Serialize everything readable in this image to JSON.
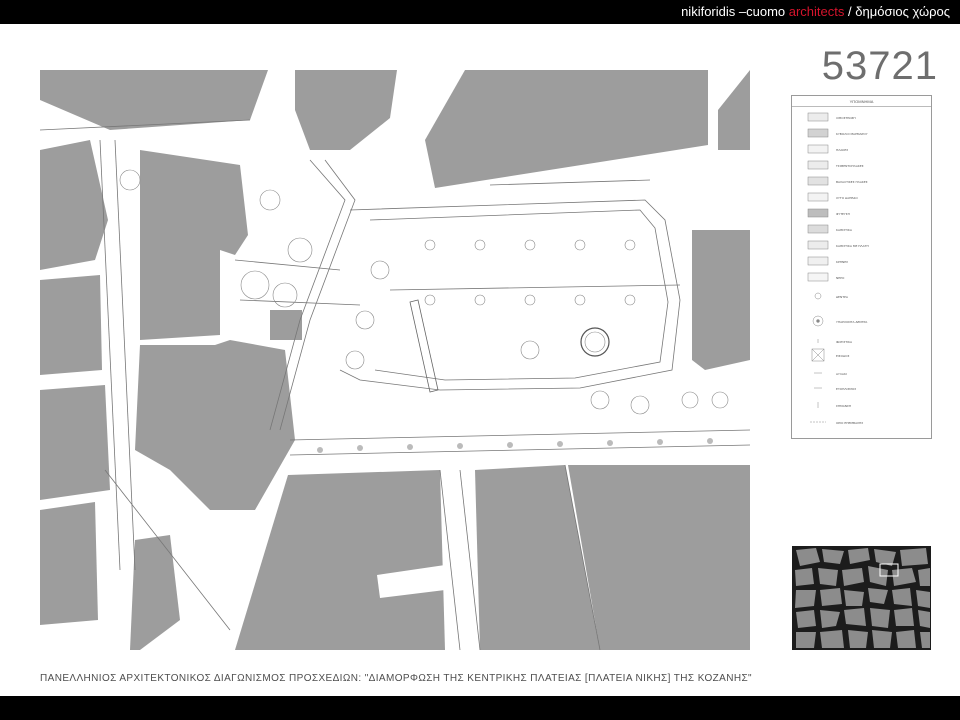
{
  "header": {
    "office": "nikiforidis –cuomo",
    "office_accent": "architects",
    "separator": "/",
    "section": "δημόσιος χώρος"
  },
  "project_number": "53721",
  "legend": {
    "title": "ΥΠΟΜΝΗΜΑ",
    "items": [
      "ΛΙΘΟΣΤΡΩΣΗ",
      "ΚΥΒΟΛΟΙ ΜΑΡΜΑΡΟΥ",
      "ΠΛΑΚΕΣ",
      "ΤΣΙΜΕΝΤΟΠΛΑΚΕΣ",
      "ΒΑΣΑΛΤΙΚΕΣ ΠΛΑΚΕΣ",
      "ΧΥΤΟ ΔΑΠΕΔΟ",
      "ΦΥΤΕΥΣΗ",
      "ΚΑΘΙΣΤΙΚΑ",
      "ΚΑΘΙΣΤΙΚΑ ΜΕ ΠΛΑΤΗ",
      "ΚΡΗΝΕΣ",
      "ΝΕΡΟ",
      "ΔΕΝΤΡΑ",
      "ΥΠΑΡΧΟΝΤΑ ΔΕΝΤΡΑ",
      "ΦΩΤΙΣΤΙΚΑ",
      "ΕΙΣΟΔΟΣ",
      "ΑΥΛΑΚΙ",
      "ΕΞΟΠΛΙΣΜΟΣ",
      "ΣΗΜΑΝΣΗ",
      "ΟΡΙΟ ΕΠΕΜΒΑΣΗΣ"
    ]
  },
  "competition_title": "ΠΑΝΕΛΛΗΝΙΟΣ ΑΡΧΙΤΕΚΤΟΝΙΚΟΣ ΔΙΑΓΩΝΙΣΜΟΣ ΠΡΟΣΧΕΔΙΩΝ: \"ΔΙΑΜΟΡΦΩΣΗ ΤΗΣ ΚΕΝΤΡΙΚΗΣ ΠΛΑΤΕΙΑΣ [ΠΛΑΤΕΙΑ ΝΙΚΗΣ] ΤΗΣ ΚΟΖΑΝΗΣ\"",
  "colors": {
    "bar": "#000000",
    "accent": "#d4142c",
    "building": "#9d9d9d",
    "minimap_dark": "#1c1c1c",
    "minimap_light": "#8c8c8c"
  }
}
